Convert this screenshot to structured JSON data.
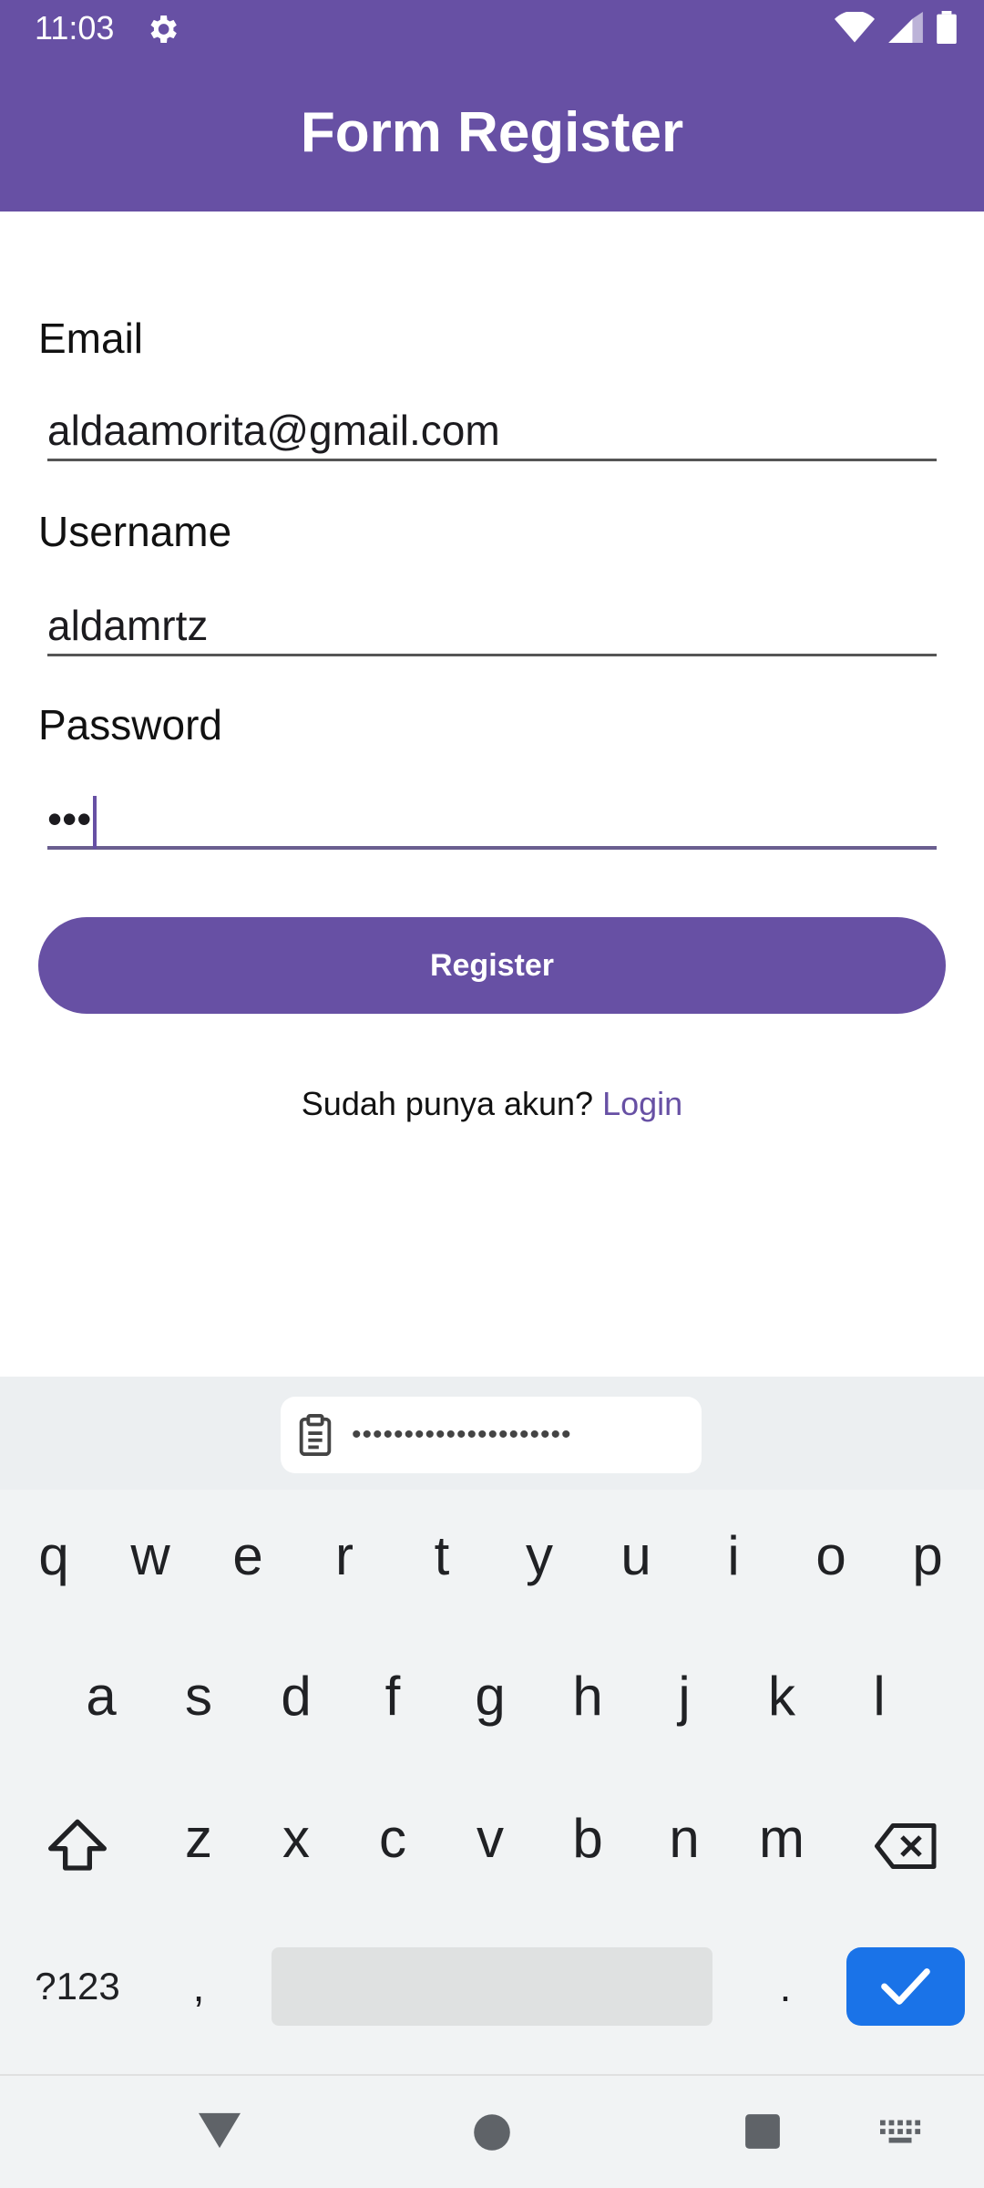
{
  "status_bar": {
    "time": "11:03",
    "icons": [
      "settings-gear-icon",
      "wifi-icon",
      "signal-icon",
      "battery-icon"
    ]
  },
  "app_bar": {
    "title": "Form Register",
    "color": "#6750a4"
  },
  "form": {
    "email": {
      "label": "Email",
      "value": "aldaamorita@gmail.com"
    },
    "username": {
      "label": "Username",
      "value": "aldamrtz"
    },
    "password": {
      "label": "Password",
      "value": "•••"
    },
    "register_button": "Register",
    "login_prompt": "Sudah punya akun?",
    "login_link": "Login"
  },
  "keyboard": {
    "clipboard_suggestion": "•••••••••••••••••••••",
    "row1": [
      "q",
      "w",
      "e",
      "r",
      "t",
      "y",
      "u",
      "i",
      "o",
      "p"
    ],
    "row2": [
      "a",
      "s",
      "d",
      "f",
      "g",
      "h",
      "j",
      "k",
      "l"
    ],
    "row3": [
      "z",
      "x",
      "c",
      "v",
      "b",
      "n",
      "m"
    ],
    "symbols_key": "?123",
    "comma_key": ",",
    "period_key": ".",
    "enter_color": "#1a73e8"
  },
  "nav_bar": {
    "icons": [
      "back-triangle-icon",
      "home-circle-icon",
      "recents-square-icon",
      "keyboard-switch-icon"
    ]
  }
}
